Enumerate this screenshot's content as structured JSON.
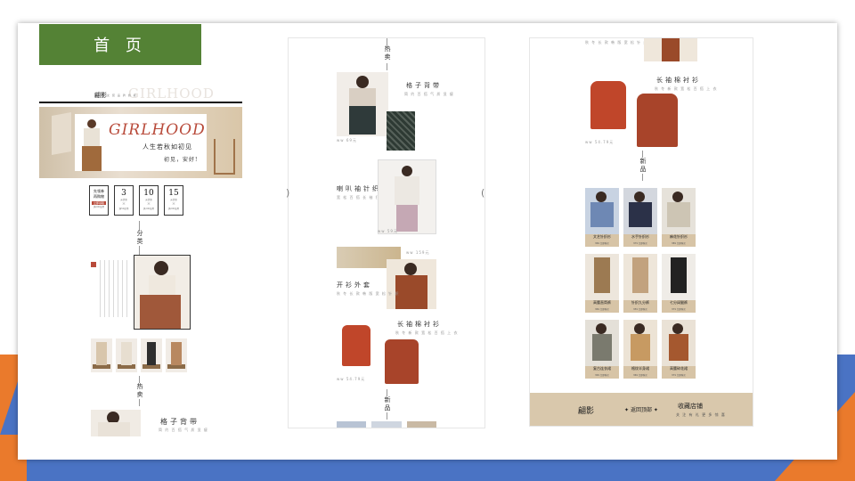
{
  "title": "首 页",
  "col1": {
    "brand": "翩影",
    "brand_sub": "女 装 品 牌 旗 舰",
    "ghost_text": "GIRLHOOD",
    "banner_title": "GIRLHOOD",
    "banner_sub": "人生若秋如初见",
    "banner_sub2": "初见，安好!",
    "coupons": [
      {
        "top": "先领券",
        "mid": "再购物",
        "badge": "立即领取",
        "note": "满200使用"
      },
      {
        "num": "3",
        "unit": "元优惠",
        "note": "满50使用"
      },
      {
        "num": "10",
        "unit": "元优惠",
        "note": "满100使用"
      },
      {
        "num": "15",
        "unit": "元优惠",
        "note": "满200使用"
      }
    ],
    "section_category": "分类",
    "section_hot": "热卖",
    "product_name": "格子背带",
    "product_sub": "简 约 百 搭 气 质 显 瘦"
  },
  "col2": {
    "section_hot": "热卖",
    "items": [
      {
        "name": "格子背带",
        "sub": "简 约 百 搭 气 质 显 瘦",
        "price": "ww 69元"
      },
      {
        "name": "喇叭袖针织衫",
        "sub": "宽 松 百 搭 长 袖 打 底 上 衣",
        "price": "ww 59元"
      },
      {
        "name": "开衫外套",
        "sub": "秋 冬 长 款 韩 版 宽 松 针 织",
        "price": "ww 159元"
      },
      {
        "name": "长袖棉衬衫",
        "sub": "秋 冬 新 款 宽 松 百 搭 上 衣",
        "price": "ww 54.79元"
      }
    ],
    "section_new": "新品"
  },
  "col3": {
    "top_note": "秋 冬 长 款 韩 版 宽 松 针 织",
    "feature_name": "长袖棉衬衫",
    "feature_sub": "秋 冬 新 款 宽 松 百 搭 上 衣",
    "feature_price": "ww 54.79元",
    "section_new": "新品",
    "grid": [
      {
        "label": "文艺针织衫",
        "sub": "¥69 立即购买"
      },
      {
        "label": "水手针织衫",
        "sub": "¥79 立即购买"
      },
      {
        "label": "麻花针织衫",
        "sub": "¥89 立即购买"
      },
      {
        "label": "高腰直筒裤",
        "sub": "¥69 立即购买"
      },
      {
        "label": "针织九分裤",
        "sub": "¥59 立即购买"
      },
      {
        "label": "七分阔腿裤",
        "sub": "¥79 立即购买"
      },
      {
        "label": "复古连衣裙",
        "sub": "¥99 立即购买"
      },
      {
        "label": "格纹半身裙",
        "sub": "¥69 立即购买"
      },
      {
        "label": "高腰碎花裙",
        "sub": "¥79 立即购买"
      }
    ],
    "footer_brand": "翩影",
    "footer_back": "返回顶部",
    "footer_fav": "收藏店铺",
    "footer_fav_sub": "关 注 有 礼 更 多 惊 喜"
  }
}
